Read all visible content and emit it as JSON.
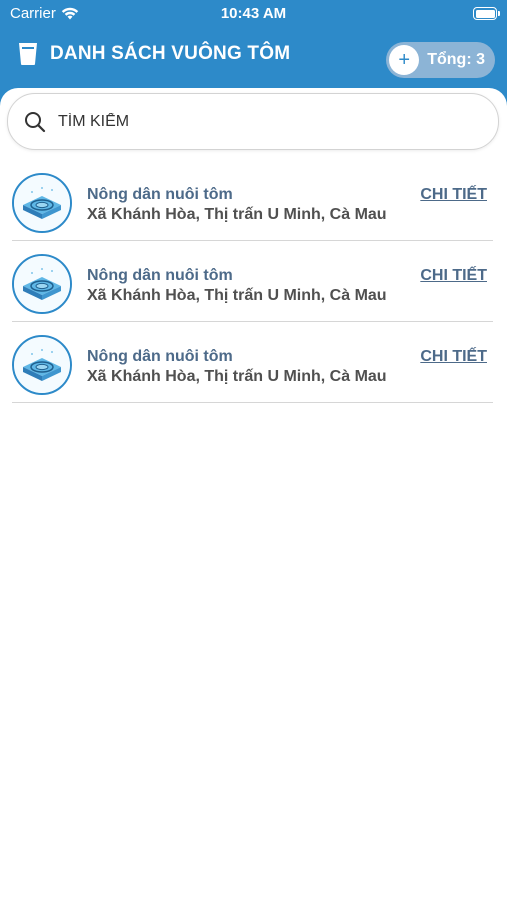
{
  "status_bar": {
    "carrier": "Carrier",
    "time": "10:43 AM"
  },
  "header": {
    "title": "DANH SÁCH VUÔNG TÔM",
    "total_label": "Tổng: 3",
    "add_symbol": "+"
  },
  "search": {
    "placeholder": "TÌM KIẾM",
    "value": ""
  },
  "ponds": [
    {
      "name": "Nông dân nuôi tôm",
      "address": "Xã Khánh Hòa, Thị trấn U Minh, Cà Mau",
      "detail_label": "CHI TIẾT"
    },
    {
      "name": "Nông dân nuôi tôm",
      "address": "Xã Khánh Hòa, Thị trấn U Minh, Cà Mau",
      "detail_label": "CHI TIẾT"
    },
    {
      "name": "Nông dân nuôi tôm",
      "address": "Xã Khánh Hòa, Thị trấn U Minh, Cà Mau",
      "detail_label": "CHI TIẾT"
    }
  ],
  "icons": {
    "wifi": "wifi-icon",
    "battery": "battery-icon",
    "pond": "pond-icon",
    "search": "search-icon",
    "add": "plus-icon"
  },
  "colors": {
    "header": "#2d8ac9",
    "accent_text": "#4d6a89",
    "pill": "#8cb4d6"
  }
}
